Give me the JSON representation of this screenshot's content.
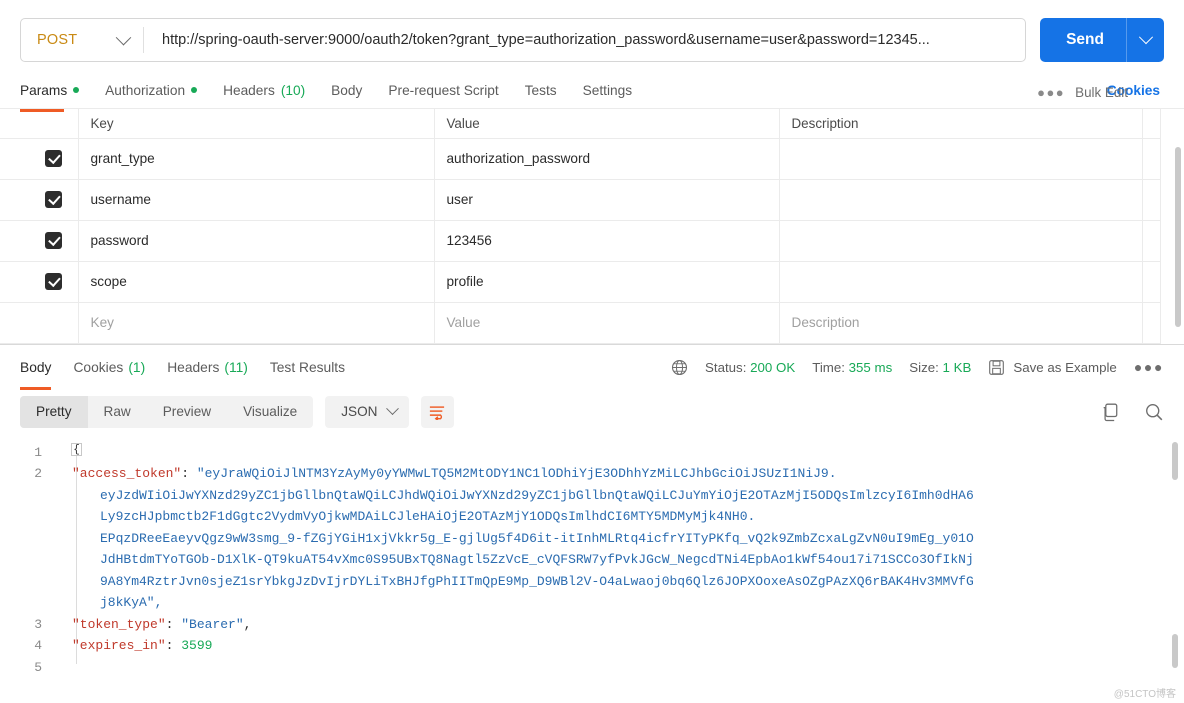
{
  "request": {
    "method": "POST",
    "url": "http://spring-oauth-server:9000/oauth2/token?grant_type=authorization_password&username=user&password=12345...",
    "send_label": "Send",
    "tabs": [
      {
        "label": "Params",
        "dot": true
      },
      {
        "label": "Authorization",
        "dot": true
      },
      {
        "label": "Headers",
        "count": "(10)"
      },
      {
        "label": "Body"
      },
      {
        "label": "Pre-request Script"
      },
      {
        "label": "Tests"
      },
      {
        "label": "Settings"
      }
    ],
    "cookies_link": "Cookies"
  },
  "params_table": {
    "headers": {
      "key": "Key",
      "value": "Value",
      "description": "Description",
      "bulk_edit": "Bulk Edit"
    },
    "rows": [
      {
        "checked": true,
        "key": "grant_type",
        "value": "authorization_password",
        "description": ""
      },
      {
        "checked": true,
        "key": "username",
        "value": "user",
        "description": ""
      },
      {
        "checked": true,
        "key": "password",
        "value": "123456",
        "description": ""
      },
      {
        "checked": true,
        "key": "scope",
        "value": "profile",
        "description": ""
      }
    ],
    "placeholder_row": {
      "key": "Key",
      "value": "Value",
      "description": "Description"
    }
  },
  "response": {
    "tabs": [
      {
        "label": "Body",
        "count": ""
      },
      {
        "label": "Cookies",
        "count": "(1)"
      },
      {
        "label": "Headers",
        "count": "(11)"
      },
      {
        "label": "Test Results",
        "count": ""
      }
    ],
    "status_label": "Status:",
    "status_value": "200 OK",
    "time_label": "Time:",
    "time_value": "355 ms",
    "size_label": "Size:",
    "size_value": "1 KB",
    "save_as_example": "Save as Example",
    "format_tabs": [
      "Pretty",
      "Raw",
      "Preview",
      "Visualize"
    ],
    "format_active": "Pretty",
    "content_type": "JSON",
    "body": {
      "lines": [
        {
          "no": "1",
          "segments": [
            {
              "t": "{",
              "c": "p"
            }
          ],
          "indent": 0
        },
        {
          "no": "2",
          "segments": [
            {
              "t": "\"access_token\"",
              "c": "k"
            },
            {
              "t": ": ",
              "c": "p"
            },
            {
              "t": "\"eyJraWQiOiJlNTM3YzAyMy0yYWMwLTQ5M2MtODY1NC1lODhiYjE3ODhhYzMiLCJhbGciOiJSUzI1NiJ9.",
              "c": "s"
            }
          ],
          "indent": 1,
          "wrapped": [
            "eyJzdWIiOiJwYXNzd29yZC1jbGllbnQtaWQiLCJhdWQiOiJwYXNzd29yZC1jbGllbnQtaWQiLCJuYmYiOjE2OTAzMjI5ODQsImlzcyI6Imh0dHA6",
            "Ly9zcHJpbmctb2F1dGgtc2VydmVyOjkwMDAiLCJleHAiOjE2OTAzMjY1ODQsImlhdCI6MTY5MDMyMjk4NH0.",
            "EPqzDReeEaeyvQgz9wW3smg_9-fZGjYGiH1xjVkkr5g_E-gjlUg5f4D6it-itInhMLRtq4icfrYITyPKfq_vQ2k9ZmbZcxaLgZvN0uI9mEg_y01O",
            "JdHBtdmTYoTGOb-D1XlK-QT9kuAT54vXmc0S95UBxTQ8Nagtl5ZzVcE_cVQFSRW7yfPvkJGcW_NegcdTNi4EpbAo1kWf54ou17i71SCCo3OfIkNj",
            "9A8Ym4RztrJvn0sjeZ1srYbkgJzDvIjrDYLiTxBHJfgPhIITmQpE9Mp_D9WBl2V-O4aLwaoj0bq6Qlz6JOPXOoxeAsOZgPAzXQ6rBAK4Hv3MMVfG",
            "j8kKyA\","
          ]
        },
        {
          "no": "3",
          "segments": [
            {
              "t": "\"token_type\"",
              "c": "k"
            },
            {
              "t": ": ",
              "c": "p"
            },
            {
              "t": "\"Bearer\"",
              "c": "s"
            },
            {
              "t": ",",
              "c": "p"
            }
          ],
          "indent": 1
        },
        {
          "no": "4",
          "segments": [
            {
              "t": "\"expires_in\"",
              "c": "k"
            },
            {
              "t": ": ",
              "c": "p"
            },
            {
              "t": "3599",
              "c": "n"
            }
          ],
          "indent": 1
        },
        {
          "no": "5",
          "segments": [
            {
              "t": "}",
              "c": "p"
            }
          ],
          "indent": 0
        }
      ]
    }
  },
  "colors": {
    "accent_orange": "#ef5b25",
    "send_blue": "#1573e6",
    "link_blue": "#1573e6",
    "status_green": "#18a957",
    "method_orange": "#c98a14",
    "json_key": "#c0392b",
    "json_string": "#2b6cb0",
    "json_number": "#18a957"
  },
  "watermark": "@51CTO博客"
}
